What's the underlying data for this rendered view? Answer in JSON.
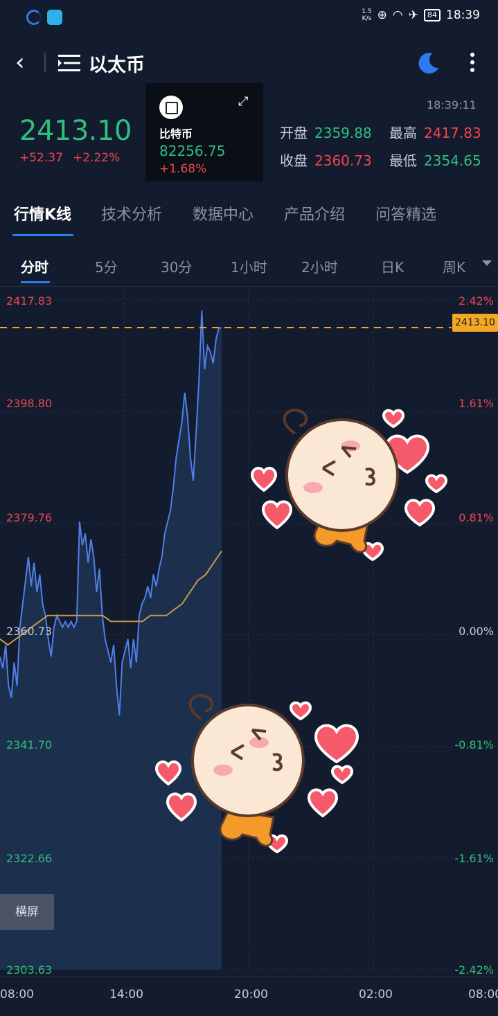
{
  "status_bar": {
    "time": "18:39",
    "speed_top": "1.5",
    "speed_bottom": "K/s",
    "battery": "84"
  },
  "nav": {
    "title": "以太币",
    "back_icon": "chevron-left-icon",
    "menu_icon": "list-icon",
    "theme_icon": "moon-icon",
    "more_icon": "more-vertical-icon"
  },
  "quote": {
    "price": "2413.10",
    "change": "+52.37",
    "change_pct": "+2.22%",
    "time": "18:39:11",
    "open_label": "开盘",
    "open": "2359.88",
    "high_label": "最高",
    "high": "2417.83",
    "close_label": "收盘",
    "close": "2360.73",
    "low_label": "最低",
    "low": "2354.65"
  },
  "mini_card": {
    "name": "比特币",
    "price": "82256.75",
    "change_pct": "+1.68%",
    "expand_icon": "expand-icon"
  },
  "tabs": [
    "行情K线",
    "技术分析",
    "数据中心",
    "产品介绍",
    "问答精选"
  ],
  "periods": [
    "分时",
    "5分",
    "30分",
    "1小时",
    "2小时",
    "日K",
    "周K"
  ],
  "landscape_button": "横屏",
  "colors": {
    "up": "#f0454d",
    "down": "#2fbf7c",
    "line": "#4f7fe8",
    "avg": "#c49a4a",
    "accent": "#2d7bf0",
    "tag": "#f5a623"
  },
  "chart_data": {
    "type": "line",
    "y_left_labels": [
      "2417.83",
      "2398.80",
      "2379.76",
      "2360.73",
      "2341.70",
      "2322.66",
      "2303.63"
    ],
    "y_right_labels": [
      "2.42%",
      "1.61%",
      "0.81%",
      "0.00%",
      "-0.81%",
      "-1.61%",
      "-2.42%"
    ],
    "ylim": [
      2303.63,
      2417.83
    ],
    "x_labels": [
      "08:00",
      "14:00",
      "20:00",
      "02:00",
      "08:00"
    ],
    "reference_price": "2360.73",
    "current_price": "2413.10",
    "series": [
      {
        "values": [
          2357,
          2355,
          2359,
          2352,
          2350,
          2356,
          2352,
          2362,
          2366,
          2370,
          2374,
          2369,
          2373,
          2368,
          2371,
          2366,
          2364,
          2360,
          2357,
          2362,
          2364,
          2363,
          2362,
          2363,
          2362,
          2363,
          2362,
          2363,
          2380,
          2376,
          2378,
          2373,
          2377,
          2374,
          2368,
          2372,
          2364,
          2360,
          2358,
          2356,
          2359,
          2352,
          2347,
          2356,
          2358,
          2360,
          2355,
          2360,
          2356,
          2364,
          2366,
          2367,
          2369,
          2367,
          2371,
          2369,
          2372,
          2374,
          2378,
          2380,
          2382,
          2386,
          2391,
          2394,
          2397,
          2402,
          2398,
          2391,
          2387,
          2395,
          2404,
          2416,
          2406,
          2410,
          2409,
          2407,
          2411,
          2413,
          2413.1
        ]
      },
      {
        "values": [
          2360,
          2359,
          2360,
          2361,
          2362,
          2363,
          2364,
          2364,
          2364,
          2364,
          2364,
          2364,
          2364,
          2364,
          2363,
          2363,
          2363,
          2363,
          2363,
          2364,
          2364,
          2364,
          2365,
          2366,
          2368,
          2370,
          2371,
          2373,
          2375
        ]
      }
    ]
  }
}
